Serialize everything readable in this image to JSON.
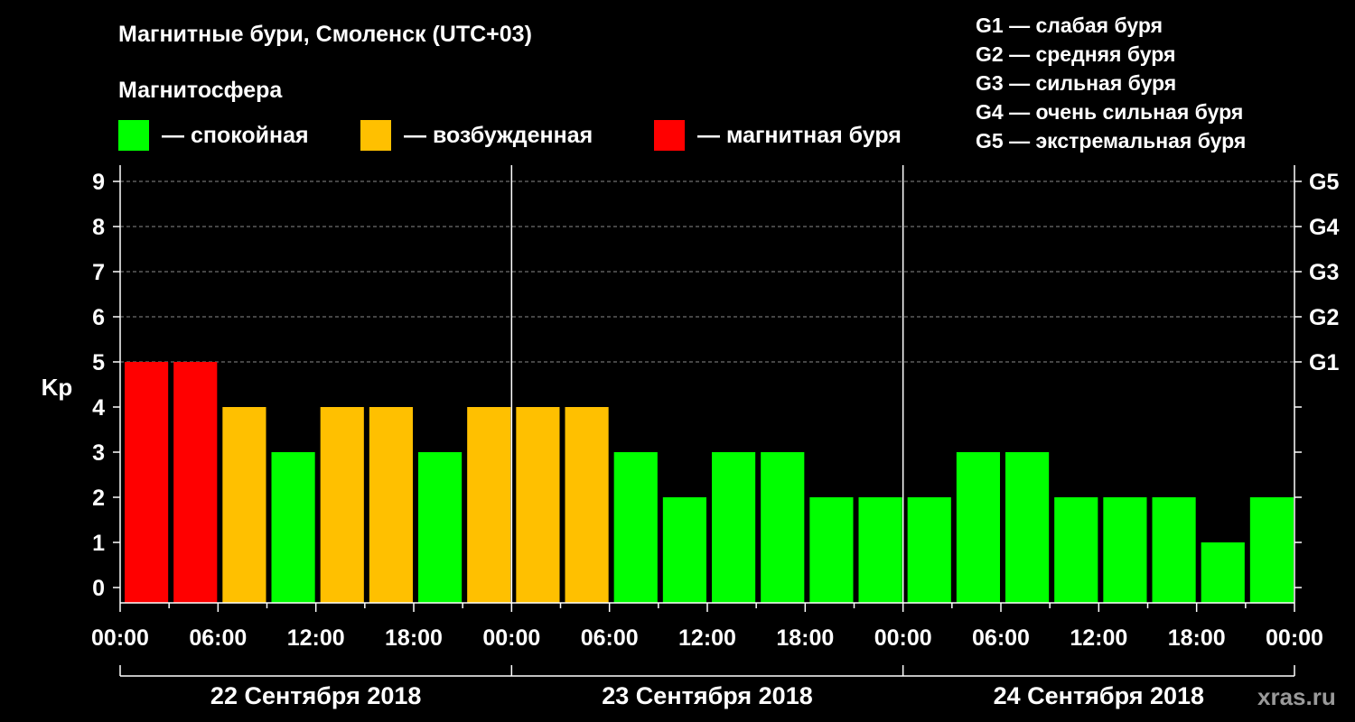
{
  "title": "Магнитные бури, Смоленск (UTC+03)",
  "magnetosphere": {
    "heading": "Магнитосфера",
    "legend": [
      {
        "label": "— спокойная",
        "color": "#00ff00"
      },
      {
        "label": "— возбужденная",
        "color": "#ffc000"
      },
      {
        "label": "— магнитная буря",
        "color": "#ff0000"
      }
    ]
  },
  "storm_scale": [
    "G1 — слабая буря",
    "G2 — средняя буря",
    "G3 — сильная буря",
    "G4 — очень сильная буря",
    "G5 — экстремальная буря"
  ],
  "watermark": "xras.ru",
  "chart_data": {
    "type": "bar",
    "ylabel": "Kp",
    "ylim": [
      0,
      9
    ],
    "y_ticks": [
      "0",
      "1",
      "2",
      "3",
      "4",
      "5",
      "6",
      "7",
      "8",
      "9"
    ],
    "right_ticks": [
      {
        "kp": 5,
        "label": "G1"
      },
      {
        "kp": 6,
        "label": "G2"
      },
      {
        "kp": 7,
        "label": "G3"
      },
      {
        "kp": 8,
        "label": "G4"
      },
      {
        "kp": 9,
        "label": "G5"
      }
    ],
    "x_tick_labels": [
      "00:00",
      "06:00",
      "12:00",
      "18:00",
      "00:00",
      "06:00",
      "12:00",
      "18:00",
      "00:00",
      "06:00",
      "12:00",
      "18:00",
      "00:00"
    ],
    "days": [
      "22 Сентября 2018",
      "23 Сентября 2018",
      "24 Сентября 2018"
    ],
    "interval_hours": 3,
    "values": [
      5,
      5,
      4,
      3,
      4,
      4,
      3,
      4,
      4,
      4,
      3,
      2,
      3,
      3,
      2,
      2,
      2,
      3,
      3,
      2,
      2,
      2,
      1,
      2
    ],
    "colors": {
      "quiet": "#00ff00",
      "active": "#ffc000",
      "storm": "#ff0000"
    },
    "grid": true
  }
}
